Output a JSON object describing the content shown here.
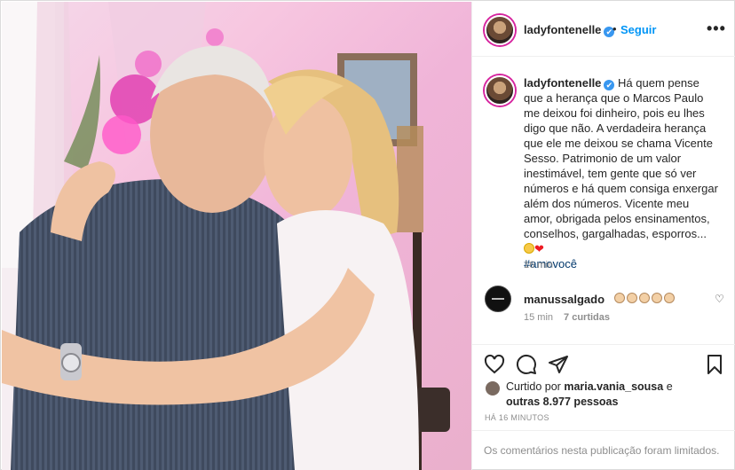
{
  "post": {
    "username": "ladyfontenelle",
    "verified_mark": "✔",
    "dot": "•",
    "follow_label": "Seguir",
    "more_label": "•••"
  },
  "caption": {
    "username": "ladyfontenelle",
    "text": "Há quem pense que a herança que o Marcos Paulo me deixou foi dinheiro, pois eu lhes digo que não. A verdadeira herança que ele me deixou se chama Vicente Sesso. Patrimonio de um valor inestimável, tem gente que só ver números e há quem consiga enxergar além dos números. Vicente meu amor, obrigada pelos ensinamentos, conselhos, gargalhadas, esporros...",
    "emojis": [
      "laughing-face-emoji",
      "red-heart-emoji"
    ],
    "hashtag": "#amovocê",
    "time": "16 min"
  },
  "comment": {
    "username": "manussalgado",
    "emoji_count": 5,
    "emoji_name": "clapping-hands-emoji",
    "time": "15 min",
    "replies": "7 curtidas",
    "heart_icon": "heart-outline-icon"
  },
  "likes": {
    "prefix": "Curtido por",
    "first_user": "maria.vania_sousa",
    "connector": "e",
    "others": "outras 8.977 pessoas"
  },
  "time_ago": "HÁ 16 MINUTOS",
  "comments_limited": "Os comentários nesta publicação foram limitados.",
  "icons": {
    "like": "heart-outline-icon",
    "comment": "comment-bubble-icon",
    "share": "paper-plane-icon",
    "save": "bookmark-icon"
  },
  "colors": {
    "link_blue": "#0095f6",
    "verified_blue": "#3897f0",
    "muted_gray": "#8e8e8e",
    "text": "#262626",
    "hashtag": "#00376b"
  }
}
